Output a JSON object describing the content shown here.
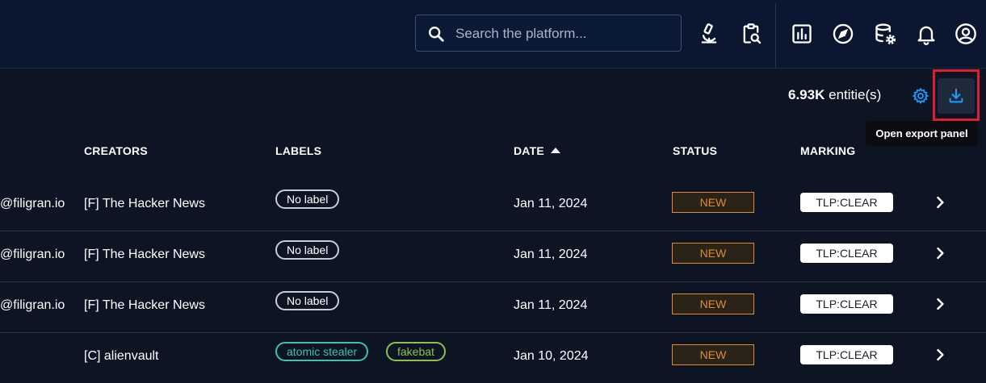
{
  "search": {
    "placeholder": "Search the platform..."
  },
  "topbar_icons": [
    "microscope-icon",
    "clipboard-search-icon",
    "dashboard-icon",
    "compass-icon",
    "database-settings-icon",
    "bell-icon",
    "account-icon"
  ],
  "toolbar": {
    "count_value": "6.93K",
    "count_unit": "entitie(s)",
    "tooltip": "Open export panel"
  },
  "columns": {
    "creators": "CREATORS",
    "labels": "LABELS",
    "date": "DATE",
    "status": "STATUS",
    "marking": "MARKING"
  },
  "rows": [
    {
      "author": "@filigran.io",
      "creator": "[F] The Hacker News",
      "labels": [
        "No label"
      ],
      "date": "Jan 11, 2024",
      "status": "NEW",
      "marking": "TLP:CLEAR"
    },
    {
      "author": "@filigran.io",
      "creator": "[F] The Hacker News",
      "labels": [
        "No label"
      ],
      "date": "Jan 11, 2024",
      "status": "NEW",
      "marking": "TLP:CLEAR"
    },
    {
      "author": "@filigran.io",
      "creator": "[F] The Hacker News",
      "labels": [
        "No label"
      ],
      "date": "Jan 11, 2024",
      "status": "NEW",
      "marking": "TLP:CLEAR"
    },
    {
      "author": "",
      "creator": "[C] alienvault",
      "labels": [
        "atomic stealer",
        "fakebat"
      ],
      "date": "Jan 10, 2024",
      "status": "NEW",
      "marking": "TLP:CLEAR"
    }
  ],
  "colors": {
    "status_new": "#e18b2e",
    "label_atomic_stealer": "#3fc3a0",
    "label_fakebat": "#8bc34a",
    "label_none": "#c9ced6",
    "highlight": "#e01e2d",
    "accent": "#1a9cff"
  }
}
